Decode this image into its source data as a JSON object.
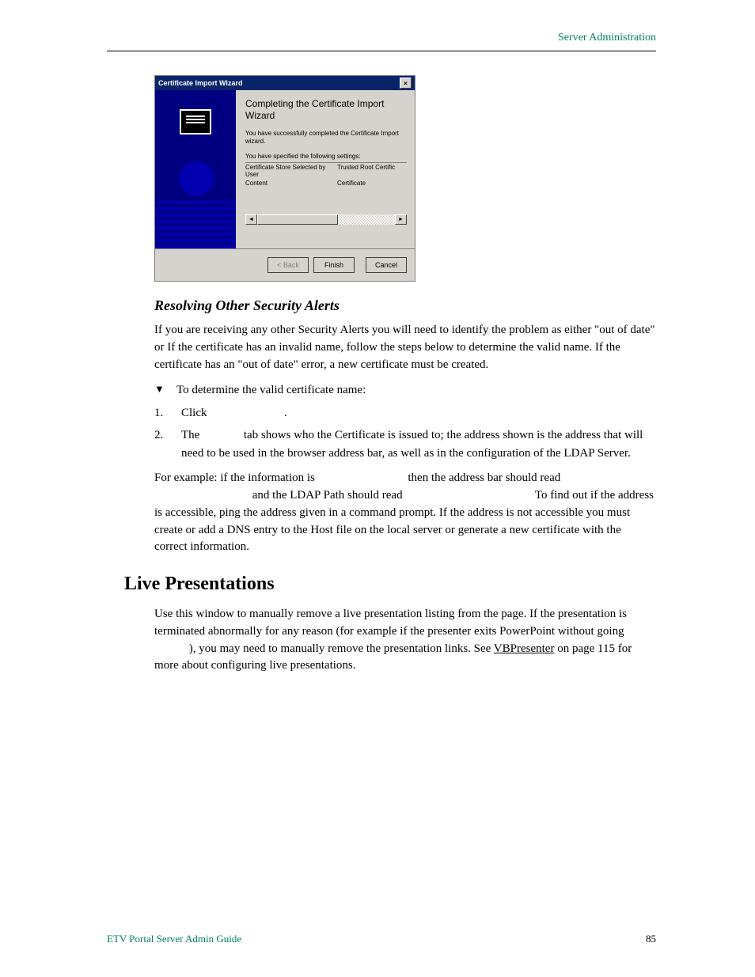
{
  "header": {
    "right": "Server Administration"
  },
  "wizard": {
    "title": "Certificate Import Wizard",
    "close_glyph": "×",
    "heading": "Completing the Certificate Import Wizard",
    "line1": "You have successfully completed the Certificate Import wizard.",
    "line2": "You have specified the following settings:",
    "rows": [
      {
        "c1": "Certificate Store Selected by User",
        "c2": "Trusted Root Certific"
      },
      {
        "c1": "Content",
        "c2": "Certificate"
      }
    ],
    "scroll_left": "◄",
    "scroll_right": "►",
    "buttons": {
      "back": "< Back",
      "finish": "Finish",
      "cancel": "Cancel"
    }
  },
  "section1": {
    "heading": "Resolving Other Security Alerts",
    "p1a": "If you are receiving any other Security Alerts you will need to identify the problem as either \"out of date\" or ",
    "p1b": " If the certificate has an invalid name, follow the steps below to determine the valid name. If the certificate has an \"out of date\" error, a new certificate must be created.",
    "bullet": "To determine the valid certificate name:",
    "step1": "Click ",
    "step1b": ".",
    "step2a": "The ",
    "step2b": " tab shows who the Certificate is issued to; the address shown is the address that will need to be used in the browser address bar, as well as in the configuration of the LDAP Server.",
    "p2a": "For example: if the information is ",
    "p2b": " then the address bar should read ",
    "p2c": " and the LDAP Path should read ",
    "p2d": " To find out if the address is accessible, ping the address given in a command prompt. If the address is not accessible you must create or add a DNS entry to the Host file on the local server or generate a new certificate with the correct information."
  },
  "section2": {
    "heading": "Live Presentations",
    "p1a": "Use this window to manually remove a live presentation listing from the ",
    "p1b": " page. If the presentation is terminated abnormally for any reason (for example if the presenter exits PowerPoint without going ",
    "p1c": "), you may need to manually remove the presentation links. See ",
    "link": "VBPresenter",
    "p1d": " on page 115 for more about configuring live presentations."
  },
  "footer": {
    "left": "ETV Portal Server Admin Guide",
    "right": "85"
  }
}
